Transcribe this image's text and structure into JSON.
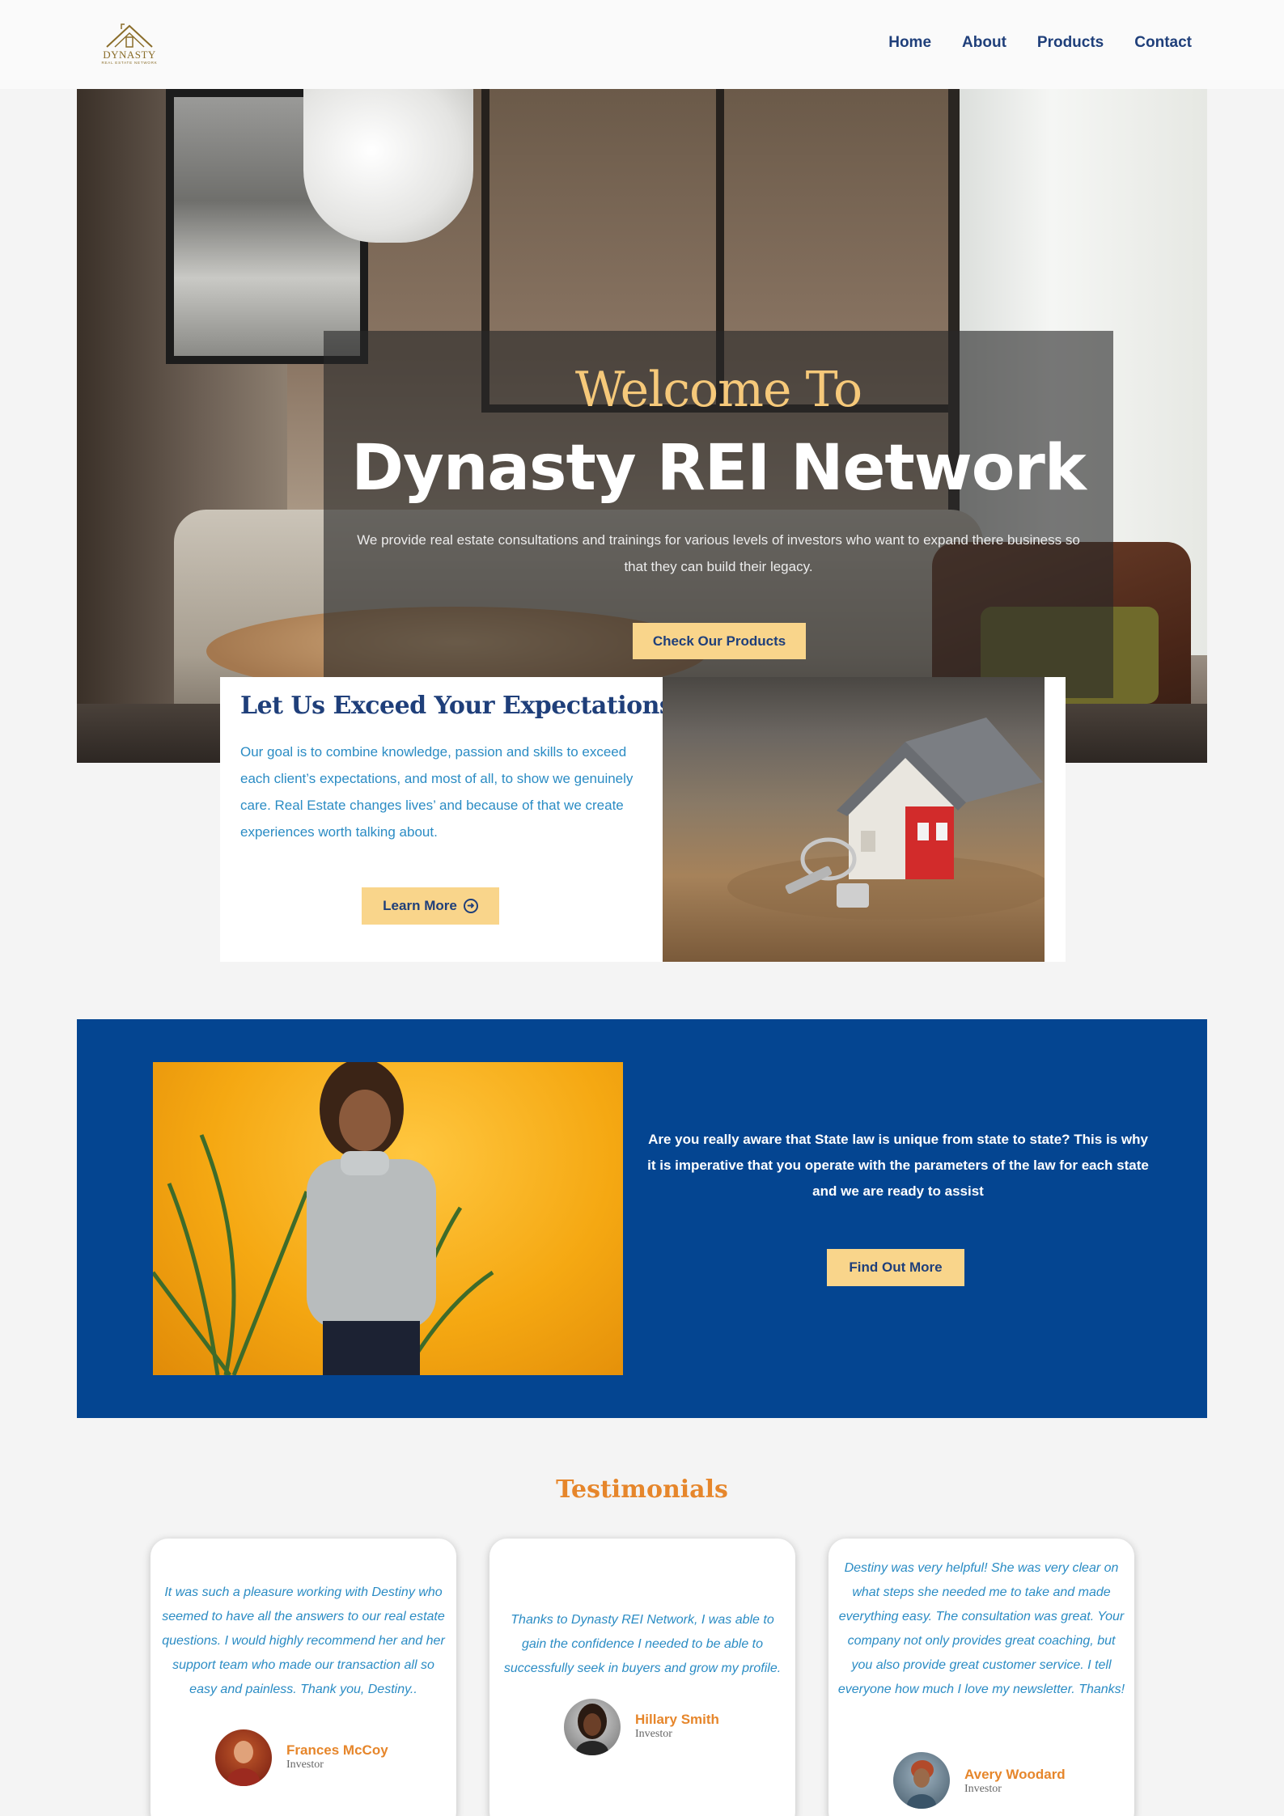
{
  "header": {
    "logo_text": "DYNASTY",
    "logo_sub": "REAL ESTATE NETWORK",
    "nav": [
      "Home",
      "About",
      "Products",
      "Contact"
    ]
  },
  "hero": {
    "welcome": "Welcome To",
    "title": "Dynasty REI Network",
    "text": "We provide real estate consultations and trainings for various levels of investors who want to expand there business so that they can build their legacy.",
    "button": "Check Our Products"
  },
  "expectations": {
    "title": "Let Us Exceed Your Expectations",
    "text": "Our goal is to combine knowledge, passion and skills to exceed each client’s expectations, and most of all, to show we genuinely care. Real Estate changes lives’ and because of that we create experiences worth talking about.",
    "button": "Learn More"
  },
  "state_law": {
    "text": "Are you really aware that State law is unique from state to state? This is why it is imperative that you operate with the parameters of the law for each state and we are ready to assist",
    "button": "Find Out More"
  },
  "testimonials": {
    "heading": "Testimonials",
    "items": [
      {
        "quote": "It was such a pleasure working with Destiny who seemed to have all the answers to our real estate questions. I would highly recommend her and her support team who made our transaction all so easy and painless. Thank you, Destiny..",
        "name": "Frances McCoy",
        "role": "Investor"
      },
      {
        "quote": "Thanks to Dynasty REI Network, I was able to gain the confidence I needed to be able to successfully seek in buyers and grow my profile.",
        "name": "Hillary Smith",
        "role": "Investor"
      },
      {
        "quote": "Destiny was very helpful! She was very clear on what steps she needed me to take and made everything easy. The consultation was great. Your company not only provides great coaching, but you also provide great customer service. I tell everyone how much I love my newsletter. Thanks!",
        "name": "Avery Woodard",
        "role": "Investor"
      }
    ]
  },
  "colors": {
    "navy": "#1f3f7a",
    "gold": "#f6c97a",
    "button_yellow": "#f9d58b",
    "royal_blue": "#044591",
    "link_blue": "#2b8cc4",
    "orange": "#e6862b"
  }
}
